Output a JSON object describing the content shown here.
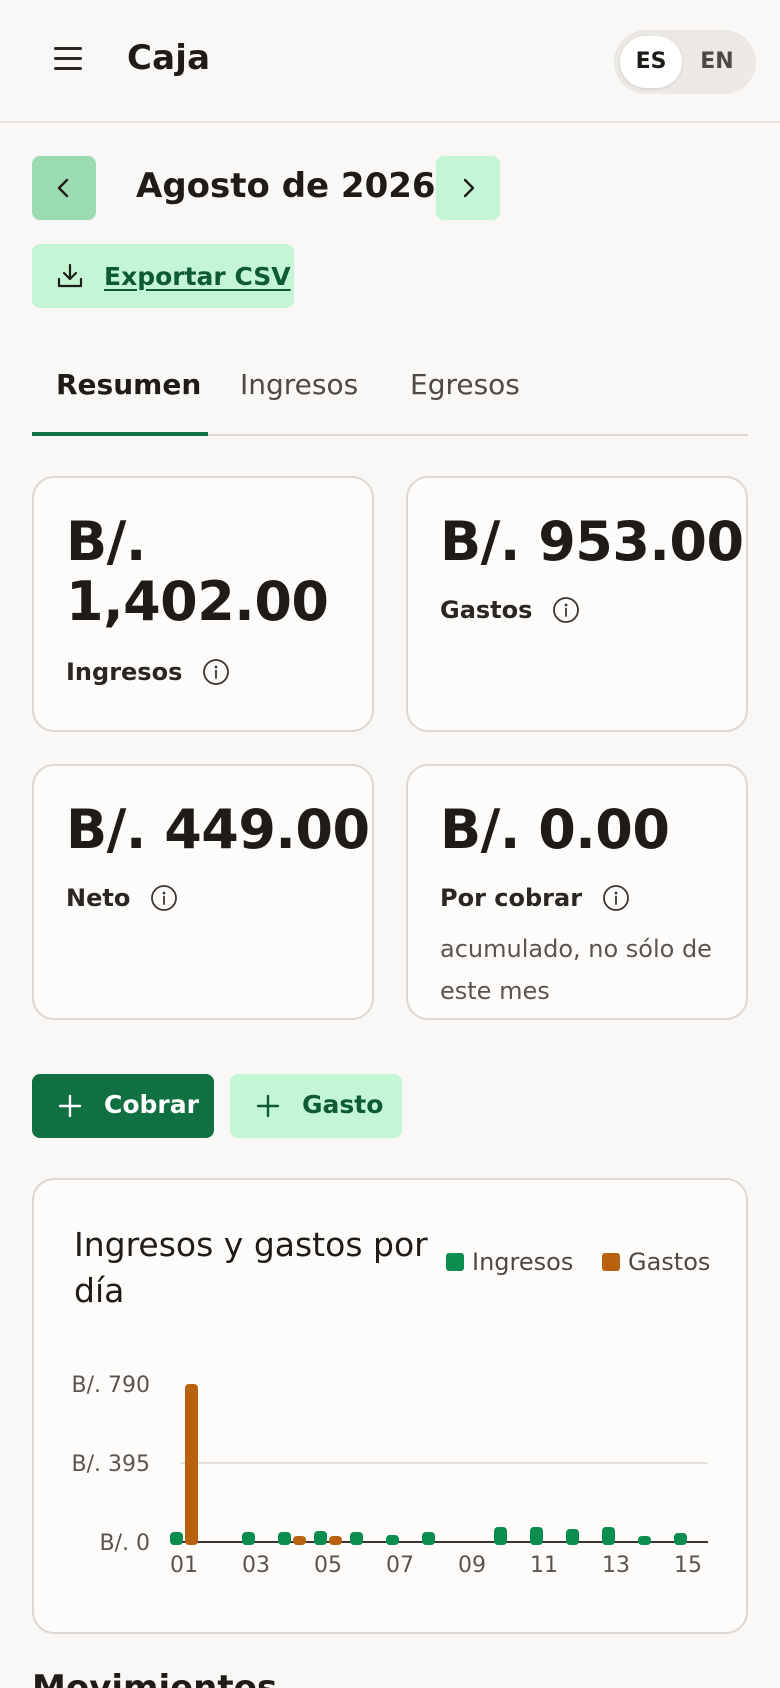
{
  "app": {
    "title": "Caja"
  },
  "language": {
    "options": [
      "ES",
      "EN"
    ],
    "selected": "ES"
  },
  "header": {
    "month": "Agosto de 2026",
    "export_label": "Exportar CSV"
  },
  "tabs": [
    {
      "label": "Resumen",
      "active": true
    },
    {
      "label": "Ingresos",
      "active": false
    },
    {
      "label": "Egresos",
      "active": false
    }
  ],
  "cards": {
    "ingresos": {
      "value_line1": "B/.",
      "value_line2": "1,402.00",
      "label": "Ingresos"
    },
    "gastos": {
      "value": "B/. 953.00",
      "label": "Gastos"
    },
    "neto": {
      "value": "B/. 449.00",
      "label": "Neto"
    },
    "por_cobrar": {
      "value": "B/. 0.00",
      "label": "Por cobrar",
      "note": "acumulado, no sólo de este mes"
    }
  },
  "actions": {
    "cobrar_label": "Cobrar",
    "gasto_label": "Gasto"
  },
  "chart": {
    "title": "Ingresos y gastos por día"
  },
  "chart_data": {
    "type": "bar",
    "title": "Ingresos y gastos por día",
    "y_tick_labels": [
      "B/. 0",
      "B/. 395",
      "B/. 790"
    ],
    "y_ticks": [
      0,
      395,
      790
    ],
    "ylim": [
      0,
      790
    ],
    "x_tick_labels": [
      "01",
      "03",
      "05",
      "07",
      "09",
      "11",
      "13",
      "15"
    ],
    "categories": [
      "01",
      "02",
      "03",
      "04",
      "05",
      "06",
      "07",
      "08",
      "09",
      "10",
      "11",
      "12",
      "13",
      "14",
      "15"
    ],
    "series": [
      {
        "name": "Ingresos",
        "color": "#0b8d50",
        "values": [
          50,
          0,
          50,
          50,
          55,
          50,
          35,
          50,
          0,
          75,
          75,
          65,
          75,
          25,
          45
        ]
      },
      {
        "name": "Gastos",
        "color": "#b8620f",
        "values": [
          790,
          0,
          0,
          30,
          18,
          0,
          0,
          0,
          0,
          0,
          0,
          0,
          0,
          0,
          0
        ]
      }
    ],
    "grid": true,
    "legend_position": "top-right"
  },
  "movements": {
    "heading": "Movimientos"
  },
  "icons": [
    "menu-icon",
    "chevron-left-icon",
    "chevron-right-icon",
    "download-icon",
    "info-icon",
    "plus-icon"
  ]
}
